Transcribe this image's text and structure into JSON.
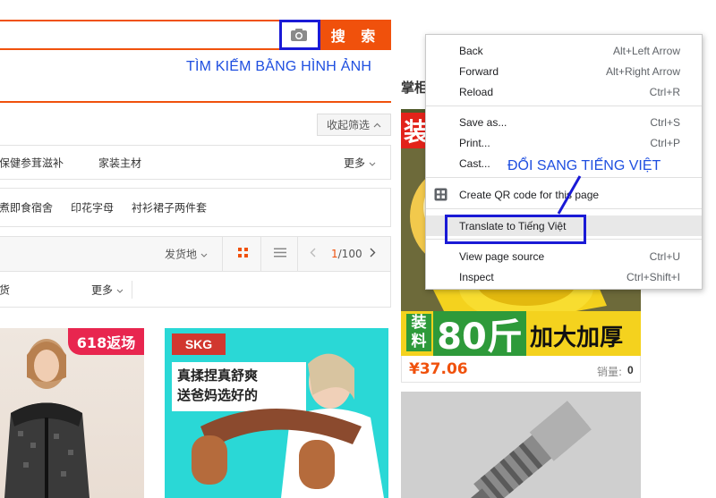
{
  "search": {
    "button_label": "搜 索",
    "camera_icon": "camera-icon",
    "image_search_annotation": "TÌM KIẾM BẰNG HÌNH ẢNH"
  },
  "filters": {
    "collapse_label": "收起筛选",
    "row1": [
      "保健参茸滋补",
      "家装主材"
    ],
    "row1_more": "更多",
    "row2": [
      "煮即食宿舍",
      "印花字母",
      "衬衫裙子两件套"
    ]
  },
  "sort": {
    "ship_from": "发货地",
    "page_current": "1",
    "page_total": "/100",
    "row2_left": "货",
    "row2_more": "更多"
  },
  "products": {
    "p1_badge": "618返场",
    "p2_brand": "SKG",
    "p2_tag": "真揉捏真舒爽\n送爸妈选好的",
    "p3_top_text": "装",
    "p3_banner_left": "装料",
    "p3_banner_big": "80斤",
    "p3_banner_right": "加大加厚",
    "p3_price": "¥37.06",
    "p3_sales_label": "销量:",
    "p3_sales_value": "0"
  },
  "side_title": "掌柜",
  "context_menu": {
    "items": [
      {
        "label": "Back",
        "shortcut": "Alt+Left Arrow"
      },
      {
        "label": "Forward",
        "shortcut": "Alt+Right Arrow"
      },
      {
        "label": "Reload",
        "shortcut": "Ctrl+R"
      },
      {
        "label": "Save as...",
        "shortcut": "Ctrl+S"
      },
      {
        "label": "Print...",
        "shortcut": "Ctrl+P"
      },
      {
        "label": "Cast...",
        "shortcut": ""
      },
      {
        "label": "Create QR code for this page",
        "shortcut": ""
      },
      {
        "label": "Translate to Tiếng Việt",
        "shortcut": ""
      },
      {
        "label": "View page source",
        "shortcut": "Ctrl+U"
      },
      {
        "label": "Inspect",
        "shortcut": "Ctrl+Shift+I"
      }
    ],
    "annotation": "ĐỔI SANG TIẾNG VIỆT"
  },
  "colors": {
    "accent": "#f0510c",
    "annotation_blue": "#1a1ad6",
    "price_red": "#f0510c"
  }
}
